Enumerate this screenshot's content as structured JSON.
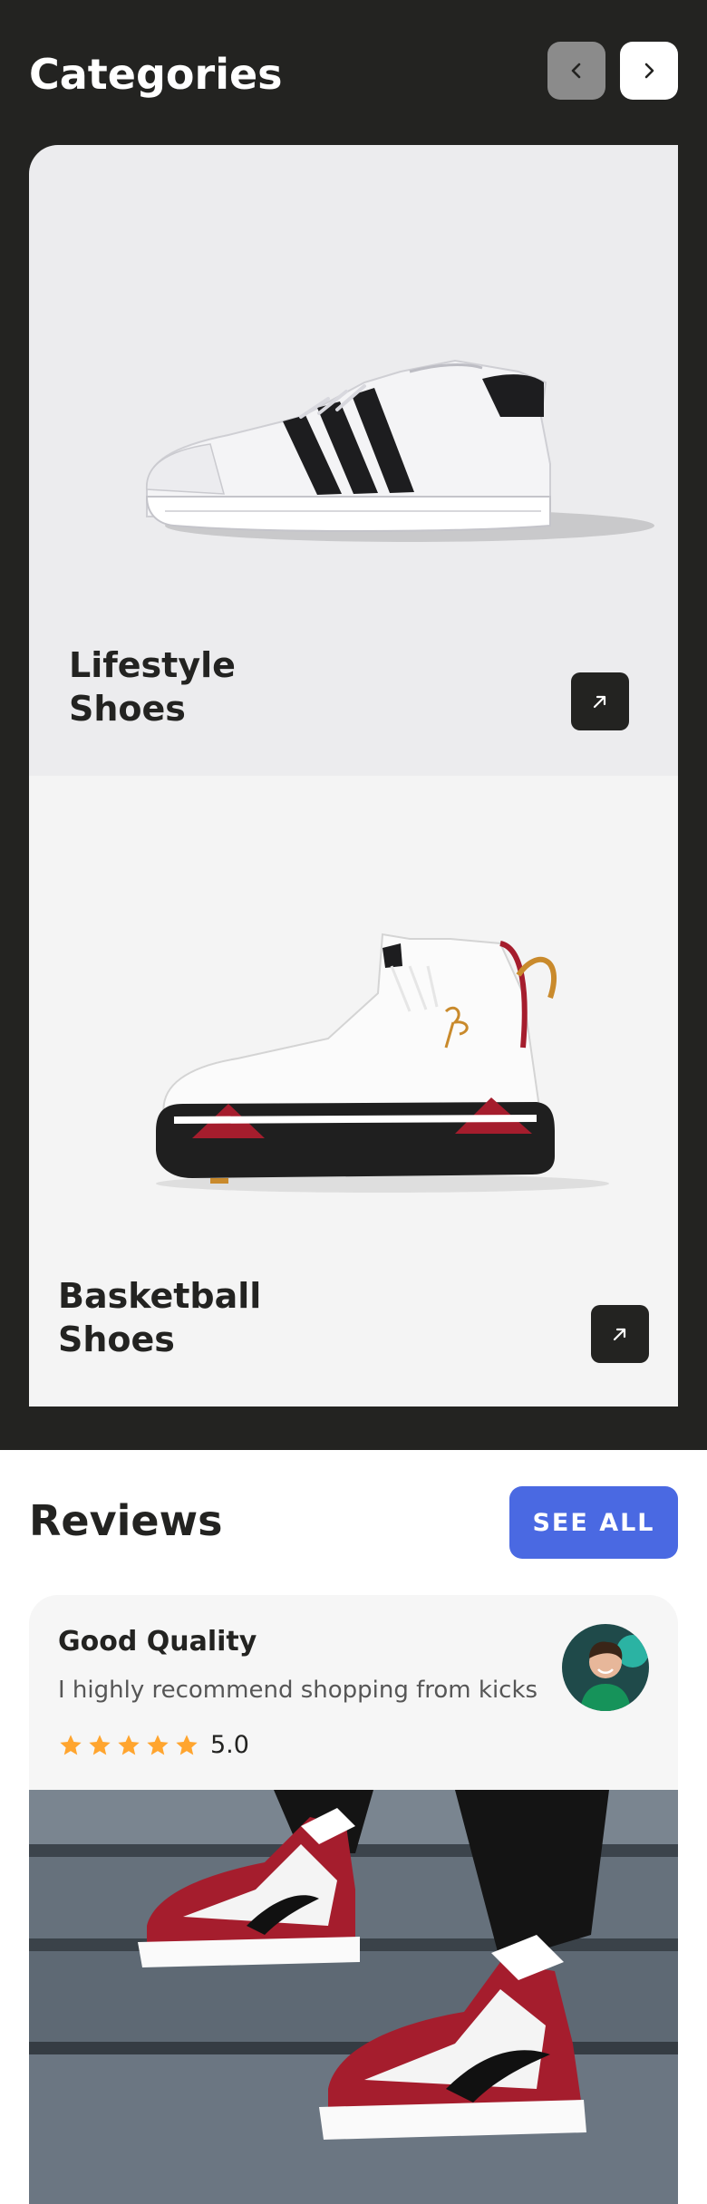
{
  "categories": {
    "title": "Categories",
    "prev_icon": "chevron-left-icon",
    "next_icon": "chevron-right-icon",
    "items": [
      {
        "label": "Lifestyle Shoes",
        "image": "white-sneaker-black-stripes",
        "action_icon": "arrow-up-right-icon"
      },
      {
        "label": "Basketball Shoes",
        "image": "white-red-basketball-high-top",
        "action_icon": "arrow-up-right-icon"
      }
    ]
  },
  "reviews": {
    "title": "Reviews",
    "see_all_label": "SEE ALL",
    "items": [
      {
        "heading": "Good Quality",
        "text": "I highly recommend shopping from kicks",
        "rating": 5,
        "rating_label": "5.0",
        "avatar": "user-avatar",
        "photo": "red-white-sneakers-on-stairs"
      }
    ]
  },
  "colors": {
    "dark": "#232321",
    "accent": "#4a69e2",
    "star": "#ffa52f",
    "card_light": "#ececee"
  }
}
